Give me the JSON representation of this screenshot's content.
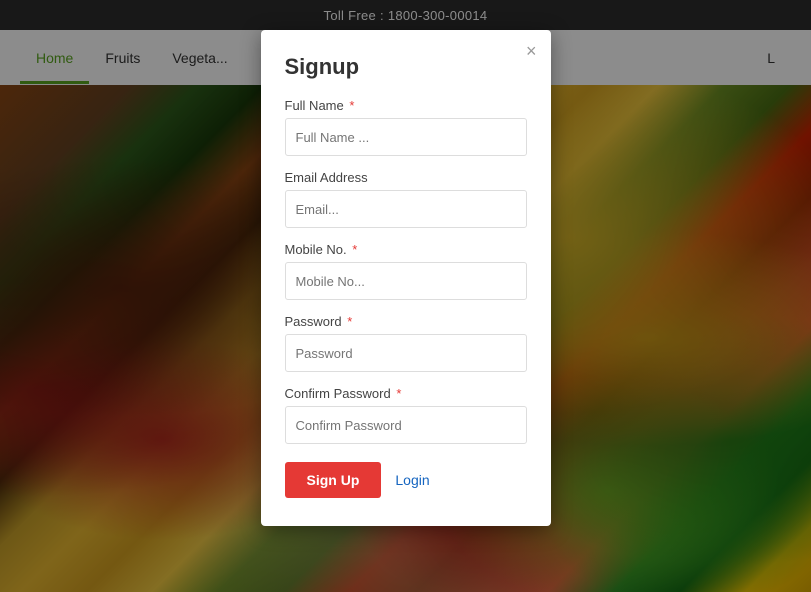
{
  "topbar": {
    "label": "Toll Free",
    "phone": " : 1800-300-00014"
  },
  "navbar": {
    "items": [
      {
        "label": "Home",
        "active": true
      },
      {
        "label": "Fruits",
        "active": false
      },
      {
        "label": "Vegeta...",
        "active": false
      },
      {
        "label": "L",
        "active": false
      }
    ]
  },
  "modal": {
    "title": "Signup",
    "close_label": "×",
    "fields": [
      {
        "id": "full-name",
        "label": "Full Name",
        "required": true,
        "placeholder": "Full Name ..."
      },
      {
        "id": "email",
        "label": "Email Address",
        "required": false,
        "placeholder": "Email..."
      },
      {
        "id": "mobile",
        "label": "Mobile No.",
        "required": true,
        "placeholder": "Mobile No..."
      },
      {
        "id": "password",
        "label": "Password",
        "required": true,
        "placeholder": "Password"
      },
      {
        "id": "confirm-password",
        "label": "Confirm Password",
        "required": true,
        "placeholder": "Confirm Password"
      }
    ],
    "signup_button": "Sign Up",
    "login_button": "Login"
  }
}
